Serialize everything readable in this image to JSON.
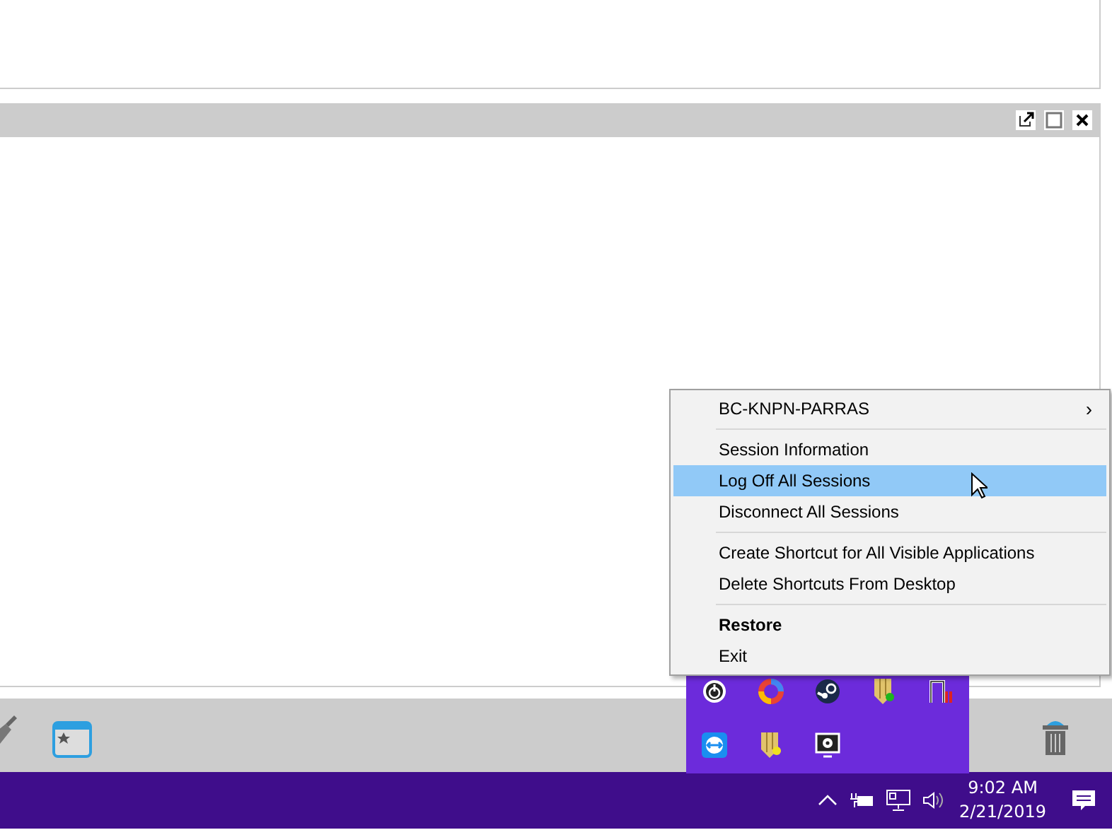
{
  "panel": {
    "controls": [
      {
        "kind": "popout"
      },
      {
        "kind": "maximize"
      },
      {
        "kind": "close"
      }
    ]
  },
  "context_menu": {
    "items": [
      {
        "kind": "item",
        "label": "BC-KNPN-PARRAS",
        "selected": false,
        "bold": false,
        "submenu": "›"
      },
      {
        "kind": "separator"
      },
      {
        "kind": "item",
        "label": "Session Information",
        "selected": false,
        "bold": false
      },
      {
        "kind": "item",
        "label": "Log Off All Sessions",
        "selected": true,
        "bold": false
      },
      {
        "kind": "item",
        "label": "Disconnect All Sessions",
        "selected": false,
        "bold": false
      },
      {
        "kind": "separator"
      },
      {
        "kind": "item",
        "label": "Create Shortcut for All Visible Applications",
        "selected": false,
        "bold": false
      },
      {
        "kind": "item",
        "label": "Delete Shortcuts From Desktop",
        "selected": false,
        "bold": false
      },
      {
        "kind": "separator"
      },
      {
        "kind": "item",
        "label": "Restore",
        "selected": false,
        "bold": true
      },
      {
        "kind": "item",
        "label": "Exit",
        "selected": false,
        "bold": false
      }
    ]
  },
  "taskbar": {
    "time": "9:02 AM",
    "date": "2/21/2019"
  }
}
